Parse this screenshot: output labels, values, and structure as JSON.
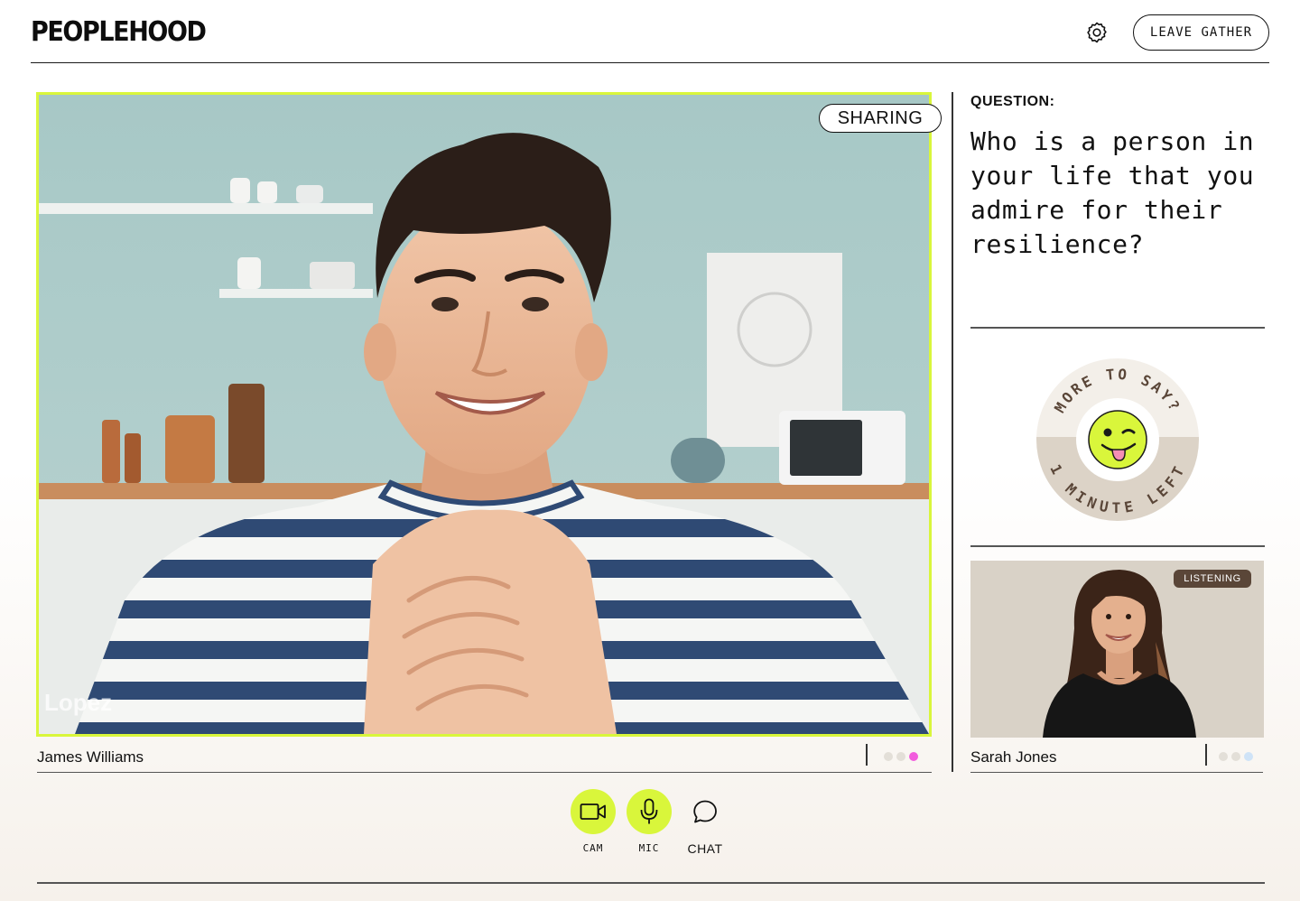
{
  "header": {
    "logo": "PEOPLEHOOD",
    "leave_label": "LEAVE GATHER"
  },
  "main_tile": {
    "badge": "SHARING",
    "watermark": "Lopez",
    "participant_name": "James Williams",
    "status_dots": [
      "#e3dfd8",
      "#e3dfd8",
      "#f25cdd"
    ]
  },
  "question": {
    "label": "QUESTION:",
    "text": "Who is a person in your life that you admire for their resilience?"
  },
  "more_badge": {
    "top_text": "MORE TO SAY?",
    "bottom_text": "1 MINUTE LEFT",
    "center_icon": "smiley-tongue-icon"
  },
  "side_tile": {
    "badge": "LISTENING",
    "participant_name": "Sarah Jones",
    "status_dots": [
      "#e3dfd8",
      "#e3dfd8",
      "#cfe3f7"
    ]
  },
  "controls": {
    "cam_label": "CAM",
    "mic_label": "MIC",
    "chat_label": "CHAT"
  },
  "colors": {
    "accent": "#d9f63b",
    "listening_bg": "#5a4638",
    "speaking_dot": "#f25cdd"
  }
}
